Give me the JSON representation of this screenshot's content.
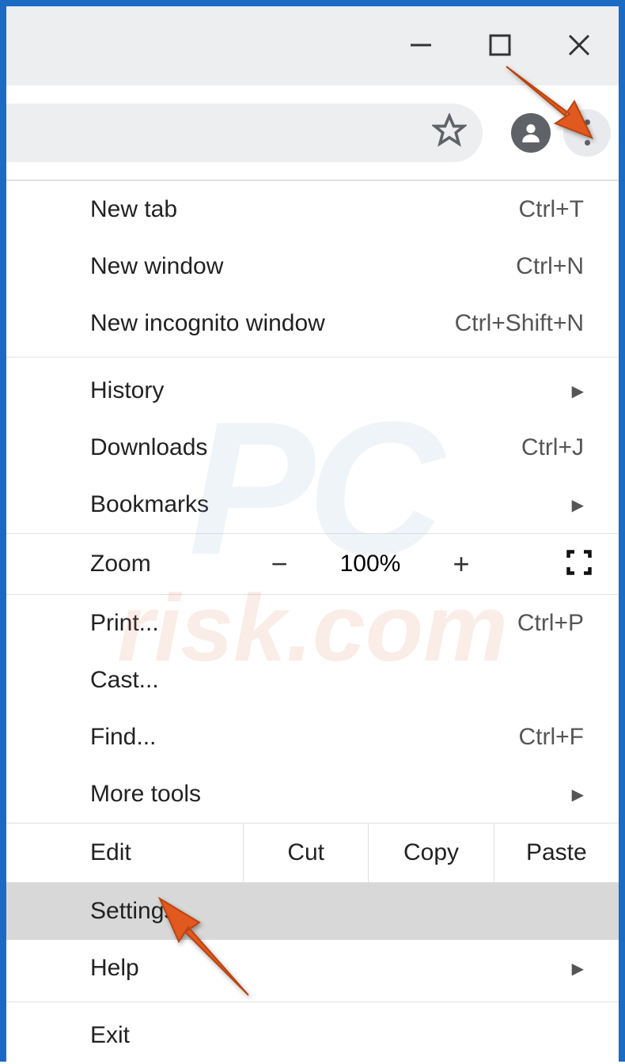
{
  "titlebar": {
    "minimize": "minimize",
    "maximize": "maximize",
    "close": "close"
  },
  "toolbar": {
    "star": "bookmark-star",
    "profile": "profile",
    "more": "more"
  },
  "menu": {
    "new_tab": {
      "label": "New tab",
      "shortcut": "Ctrl+T"
    },
    "new_window": {
      "label": "New window",
      "shortcut": "Ctrl+N"
    },
    "new_incognito": {
      "label": "New incognito window",
      "shortcut": "Ctrl+Shift+N"
    },
    "history": {
      "label": "History"
    },
    "downloads": {
      "label": "Downloads",
      "shortcut": "Ctrl+J"
    },
    "bookmarks": {
      "label": "Bookmarks"
    },
    "zoom": {
      "label": "Zoom",
      "value": "100%",
      "minus": "−",
      "plus": "+"
    },
    "print": {
      "label": "Print...",
      "shortcut": "Ctrl+P"
    },
    "cast": {
      "label": "Cast..."
    },
    "find": {
      "label": "Find...",
      "shortcut": "Ctrl+F"
    },
    "more_tools": {
      "label": "More tools"
    },
    "edit": {
      "label": "Edit",
      "cut": "Cut",
      "copy": "Copy",
      "paste": "Paste"
    },
    "settings": {
      "label": "Settings"
    },
    "help": {
      "label": "Help"
    },
    "exit": {
      "label": "Exit"
    }
  },
  "watermark": {
    "line1": "PC",
    "line2": "risk.com"
  }
}
